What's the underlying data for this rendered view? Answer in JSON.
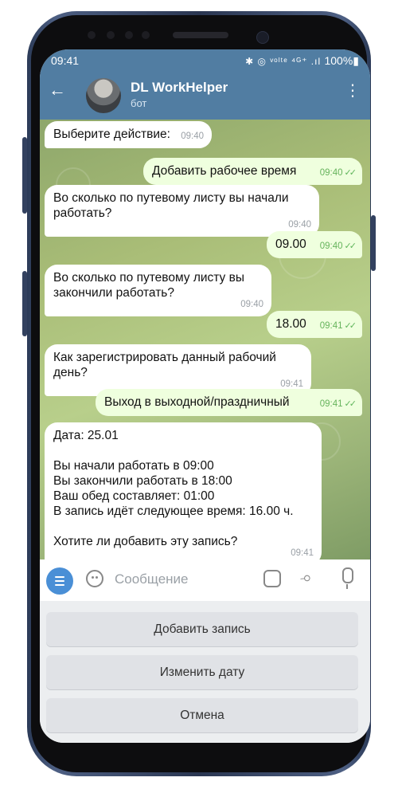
{
  "status": {
    "time": "09:41",
    "icons": "✱ ◎ ᵛᵒˡᵗᵉ ⁴ᴳ⁺ .ıl",
    "battery": "100%▮"
  },
  "header": {
    "title": "DL WorkHelper",
    "subtitle": "бот"
  },
  "messages": [
    {
      "dir": "in",
      "text": "Выберите действие:",
      "time": "09:40"
    },
    {
      "dir": "out",
      "text": "Добавить рабочее время",
      "time": "09:40"
    },
    {
      "dir": "in",
      "text": "Во сколько по путевому листу вы начали\nработать?",
      "time": "09:40"
    },
    {
      "dir": "out",
      "text": "09.00",
      "time": "09:40"
    },
    {
      "dir": "in",
      "text": "Во сколько по путевому листу вы\nзакончили работать?",
      "time": "09:40"
    },
    {
      "dir": "out",
      "text": "18.00",
      "time": "09:41"
    },
    {
      "dir": "in",
      "text": "Как зарегистрировать данный рабочий\nдень?",
      "time": "09:41"
    },
    {
      "dir": "out",
      "text": "Выход в выходной/праздничный",
      "time": "09:41"
    },
    {
      "dir": "in",
      "text": "Дата: 25.01\n\nВы начали работать в 09:00\nВы закончили работать в 18:00\nВаш обед составляет: 01:00\nВ запись идёт следующее время: 16.00 ч.\n\nХотите ли добавить эту запись?",
      "time": "09:41"
    }
  ],
  "composer": {
    "placeholder": "Сообщение"
  },
  "keyboard": {
    "buttons": [
      "Добавить запись",
      "Изменить дату",
      "Отмена"
    ]
  },
  "colors": {
    "header": "#517da2",
    "incoming": "#ffffff",
    "outgoing": "#efffde",
    "accent": "#4a8fd6"
  }
}
